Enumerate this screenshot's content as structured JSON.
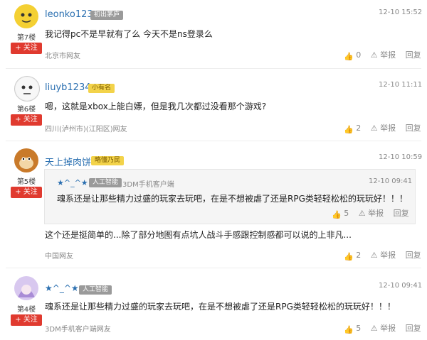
{
  "colors": {
    "accent": "#e03a2f",
    "link": "#2a6fb0",
    "badge_yellow": "#f3d34a"
  },
  "follow_label": "+ 关注",
  "actions": {
    "report": "举报",
    "reply": "回复"
  },
  "comments": [
    {
      "floor": "第7楼",
      "user": "leonko123",
      "badge": "初出茅庐",
      "time": "12-10 15:52",
      "content": "我记得pc不是早就有了么 今天不是ns登录么",
      "location": "北京市网友",
      "likes": "0"
    },
    {
      "floor": "第6楼",
      "user": "liuyb1234",
      "badge": "小有名",
      "time": "12-10 11:11",
      "content": "嗯，这就是xbox上能白嫖，但是我几次都过没看那个游戏?",
      "location": "四川(泸州市)(江阳区)网友",
      "likes": "2"
    },
    {
      "floor": "第5楼",
      "user": "天上掉肉饼",
      "badge": "略懂乃民",
      "time": "12-10 10:59",
      "quote": {
        "user": "★^_^★",
        "badge": "人工智能",
        "client": "3DM手机客户端",
        "time": "12-10 09:41",
        "content": "魂系还是让那些精力过盛的玩家去玩吧，在是不想被虐了还是RPG类轻轻松松的玩玩好！！！",
        "likes": "5"
      },
      "content": "这个还是挺简单的...除了部分地图有点坑人战斗手感跟控制感都可以说的上非凡...",
      "location": "中国网友",
      "likes": "2"
    },
    {
      "floor": "第4楼",
      "user": "★^_^★",
      "badge": "人工智能",
      "time": "12-10 09:41",
      "content": "魂系还是让那些精力过盛的玩家去玩吧，在是不想被虐了还是RPG类轻轻松松的玩玩好！！！",
      "location": "3DM手机客户端网友",
      "likes": "5"
    }
  ]
}
